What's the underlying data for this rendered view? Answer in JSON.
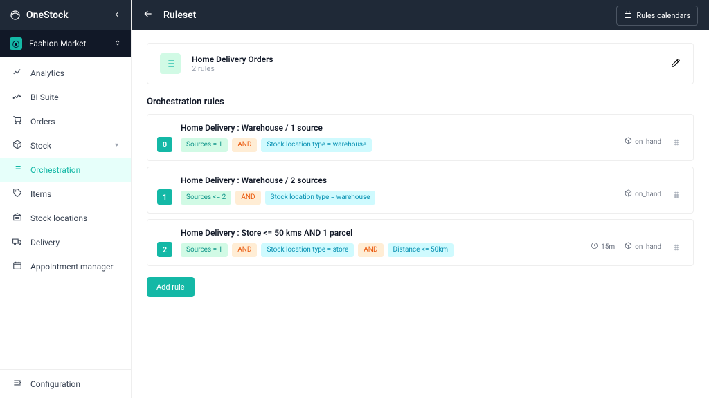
{
  "brand": "OneStock",
  "account": {
    "name": "Fashion Market"
  },
  "nav": [
    {
      "label": "Analytics",
      "icon": "analytics"
    },
    {
      "label": "BI Suite",
      "icon": "bi"
    },
    {
      "label": "Orders",
      "icon": "orders"
    },
    {
      "label": "Stock",
      "icon": "stock",
      "expandable": true
    },
    {
      "label": "Orchestration",
      "icon": "orchestration",
      "active": true
    },
    {
      "label": "Items",
      "icon": "items"
    },
    {
      "label": "Stock locations",
      "icon": "stocklocations"
    },
    {
      "label": "Delivery",
      "icon": "delivery"
    },
    {
      "label": "Appointment manager",
      "icon": "appointment"
    }
  ],
  "config_label": "Configuration",
  "page_title": "Ruleset",
  "rules_calendars_label": "Rules calendars",
  "ruleset": {
    "title": "Home Delivery Orders",
    "subtitle": "2 rules"
  },
  "section_title": "Orchestration rules",
  "rules": [
    {
      "index": "0",
      "name": "Home Delivery : Warehouse / 1 source",
      "tags": [
        {
          "kind": "src",
          "text": "Sources = 1"
        },
        {
          "kind": "and",
          "text": "AND"
        },
        {
          "kind": "loc",
          "text": "Stock location type = warehouse"
        }
      ],
      "meta": [
        {
          "icon": "cube",
          "text": "on_hand"
        }
      ]
    },
    {
      "index": "1",
      "name": "Home Delivery : Warehouse / 2 sources",
      "tags": [
        {
          "kind": "src",
          "text": "Sources <= 2"
        },
        {
          "kind": "and",
          "text": "AND"
        },
        {
          "kind": "loc",
          "text": "Stock location type = warehouse"
        }
      ],
      "meta": [
        {
          "icon": "cube",
          "text": "on_hand"
        }
      ]
    },
    {
      "index": "2",
      "name": "Home Delivery : Store <= 50 kms AND 1 parcel",
      "tags": [
        {
          "kind": "src",
          "text": "Sources = 1"
        },
        {
          "kind": "and",
          "text": "AND"
        },
        {
          "kind": "loc",
          "text": "Stock location type = store"
        },
        {
          "kind": "and",
          "text": "AND"
        },
        {
          "kind": "loc",
          "text": "Distance <= 50km"
        }
      ],
      "meta": [
        {
          "icon": "clock",
          "text": "15m"
        },
        {
          "icon": "cube",
          "text": "on_hand"
        }
      ]
    }
  ],
  "add_rule_label": "Add rule",
  "colors": {
    "accent": "#14b8a6",
    "dark": "#1f2937"
  }
}
